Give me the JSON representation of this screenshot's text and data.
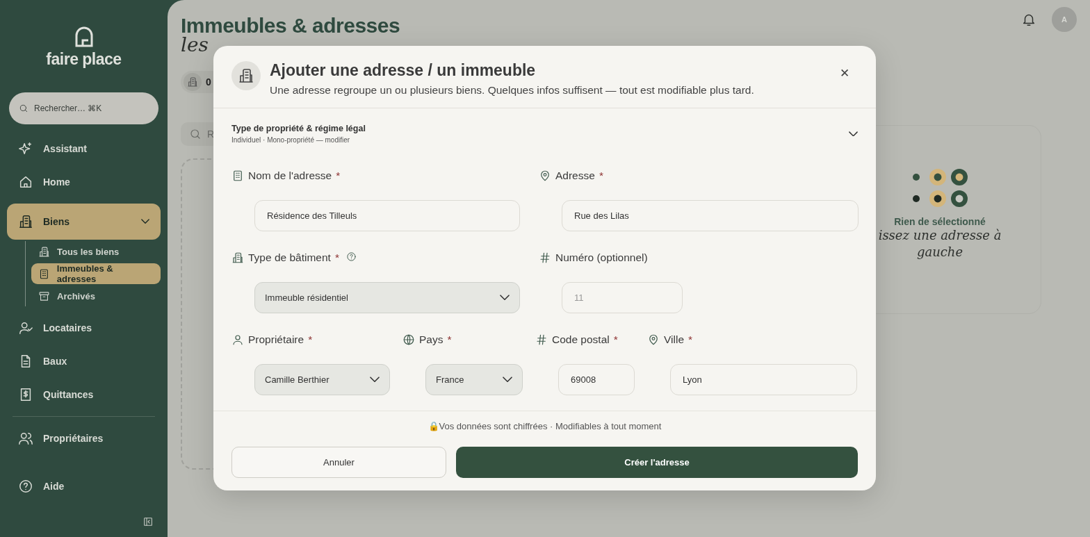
{
  "sidebar": {
    "logo": "faire place",
    "search": {
      "placeholder": "Rechercher… ⌘K"
    },
    "items": [
      {
        "label": "Assistant",
        "selected": false
      },
      {
        "label": "Home",
        "selected": false
      },
      {
        "label": "Biens",
        "selected": true,
        "expanded": true,
        "children": [
          {
            "label": "Tous les biens",
            "selected": false
          },
          {
            "label": "Immeubles & adresses",
            "selected": true
          },
          {
            "label": "Archivés",
            "selected": false
          }
        ]
      },
      {
        "label": "Locataires",
        "selected": false
      },
      {
        "label": "Baux",
        "selected": false
      },
      {
        "label": "Quittances",
        "selected": false
      },
      {
        "label": "Propriétaires",
        "selected": false
      }
    ],
    "help": {
      "label": "Aide"
    }
  },
  "header": {
    "title": "Immeubles & adresses",
    "subtitle": "les",
    "stat": "0",
    "search": {
      "placeholder": "R"
    },
    "avatar": "A"
  },
  "empty_panel": {
    "title": "Rien de sélectionné",
    "hint": "issez une adresse à gauche"
  },
  "modal": {
    "title": "Ajouter une adresse / un immeuble",
    "subtitle": "Une adresse regroupe un ou plusieurs biens. Quelques infos suffisent — tout est modifiable plus tard.",
    "section": {
      "title": "Type de propriété & régime légal",
      "summary": "Individuel · Mono-propriété — modifier",
      "expanded": false
    },
    "close": "✕",
    "rows": [
      [
        {
          "label": "Nom de l'adresse",
          "required_mark": "*",
          "kind": "text",
          "value": "Résidence des Tilleuls"
        },
        {
          "label": "Adresse",
          "required_mark": "*",
          "kind": "text",
          "value": "Rue des Lilas"
        }
      ],
      [
        {
          "label": "Type de bâtiment",
          "required_mark": "*",
          "help": true,
          "kind": "select",
          "value": "Immeuble résidentiel"
        },
        {
          "label": "Numéro (optionnel)",
          "kind": "number",
          "placeholder": "11"
        }
      ],
      [
        {
          "label": "Propriétaire",
          "required_mark": "*",
          "kind": "select",
          "value": "Camille Berthier"
        },
        {
          "label": "Pays",
          "required_mark": "*",
          "kind": "select",
          "value": "France"
        },
        {
          "label": "Code postal",
          "required_mark": "*",
          "kind": "text",
          "value": "69008"
        },
        {
          "label": "Ville",
          "required_mark": "*",
          "kind": "text",
          "value": "Lyon"
        }
      ]
    ],
    "note": "🔒Vos données sont chiffrées · Modifiables à tout moment",
    "buttons": [
      {
        "label": "Annuler",
        "kind": "secondary"
      },
      {
        "label": "Créer l'adresse",
        "kind": "primary"
      }
    ]
  }
}
